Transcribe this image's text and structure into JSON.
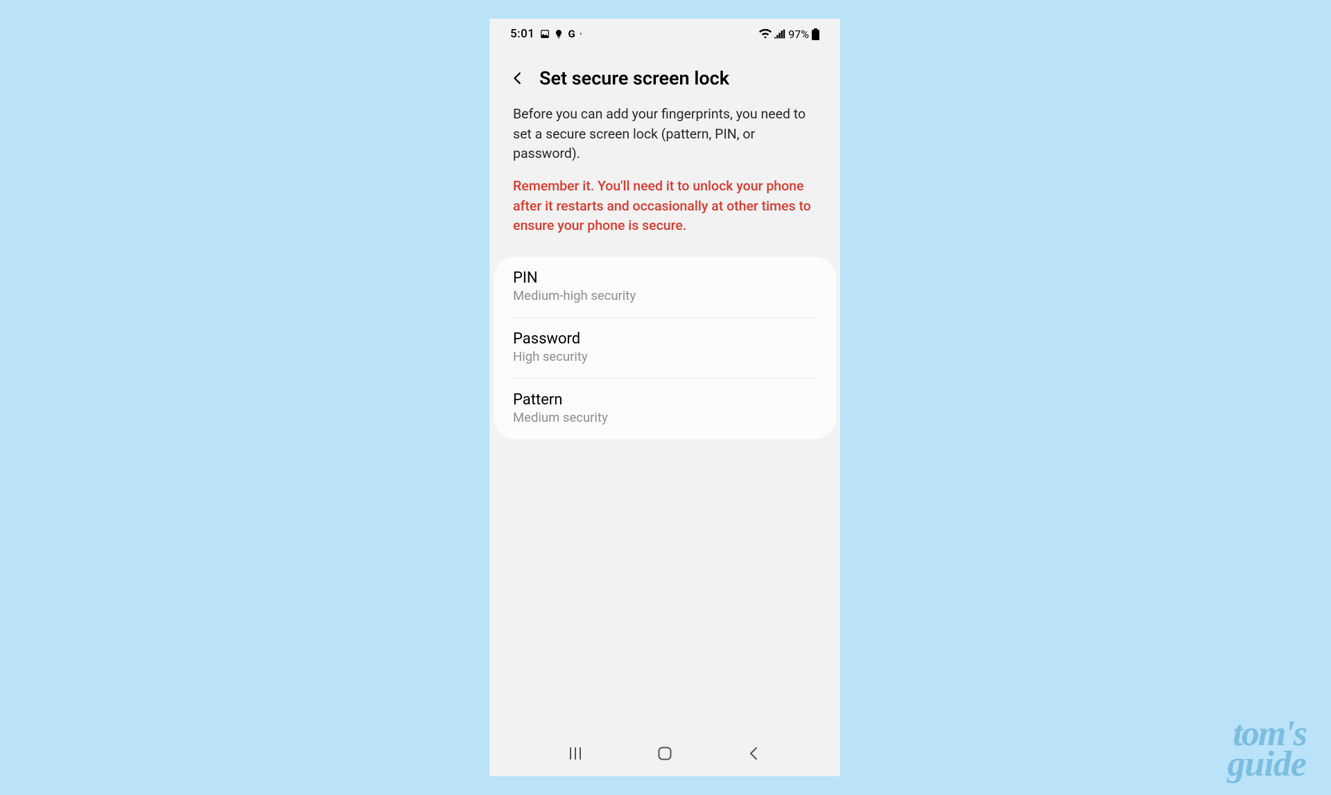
{
  "status": {
    "time": "5:01",
    "battery_pct": "97%"
  },
  "header": {
    "title": "Set secure screen lock"
  },
  "description": "Before you can add your fingerprints, you need to set a secure screen lock (pattern, PIN, or password).",
  "warning": "Remember it. You'll need it to unlock your phone after it restarts and occasionally at other times to ensure your phone is secure.",
  "options": [
    {
      "title": "PIN",
      "subtitle": "Medium-high security"
    },
    {
      "title": "Password",
      "subtitle": "High security"
    },
    {
      "title": "Pattern",
      "subtitle": "Medium security"
    }
  ],
  "watermark": {
    "line1": "tom's",
    "line2": "guide"
  }
}
